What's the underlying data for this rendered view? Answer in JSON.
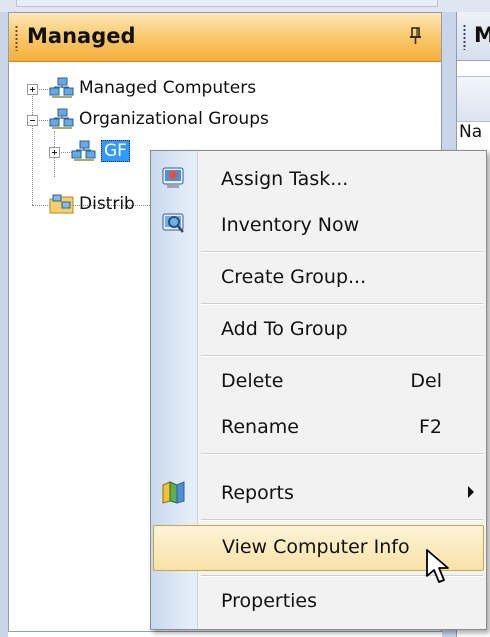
{
  "panel": {
    "title": "Managed"
  },
  "right_panel": {
    "title": "M",
    "column_label": "Na"
  },
  "tree": {
    "nodes": [
      {
        "label": "Managed Computers",
        "icon": "network-computers-icon",
        "expander": "plus"
      },
      {
        "label": "Organizational Groups",
        "icon": "network-computers-icon",
        "expander": "minus"
      },
      {
        "label": "GF",
        "icon": "network-computers-icon",
        "expander": "plus",
        "selected": true
      },
      {
        "label": "Distrib",
        "icon": "folder-distribution-icon"
      }
    ]
  },
  "context_menu": {
    "items": [
      {
        "label": "Assign Task...",
        "icon": "assign-task-icon"
      },
      {
        "label": "Inventory Now",
        "icon": "inventory-scan-icon"
      },
      {
        "label": "Create Group..."
      },
      {
        "label": "Add To Group"
      },
      {
        "label": "Delete",
        "shortcut": "Del"
      },
      {
        "label": "Rename",
        "shortcut": "F2"
      },
      {
        "label": "Reports",
        "icon": "reports-icon",
        "submenu": true
      },
      {
        "label": "View Computer Info",
        "highlighted": true
      },
      {
        "label": "Properties"
      }
    ]
  },
  "colors": {
    "header_orange": "#f5ae3a",
    "selection_blue": "#3399ff",
    "menu_highlight": "#f8e2a6"
  }
}
